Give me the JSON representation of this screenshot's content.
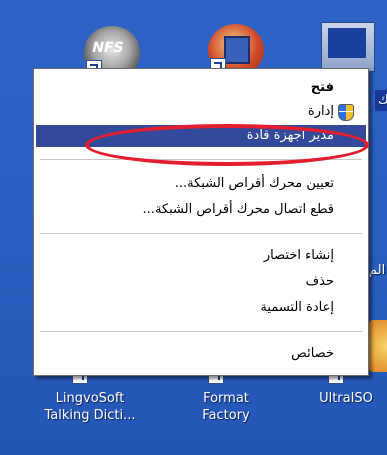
{
  "desktop": {
    "icons_top": [
      {
        "name": "nfs",
        "caption": "",
        "badge": "NFS"
      },
      {
        "name": "director",
        "caption": ""
      },
      {
        "name": "computer",
        "caption": ""
      }
    ],
    "partial_labels": [
      "الك",
      "الم"
    ],
    "icons_bottom": [
      {
        "line1": "LingvoSoft",
        "line2": "Talking Dicti..."
      },
      {
        "line1": "Format",
        "line2": "Factory"
      },
      {
        "line1": "UltraISO",
        "line2": ""
      }
    ]
  },
  "context_menu": {
    "items": [
      {
        "label": "فتح",
        "bold": true
      },
      {
        "label": "إدارة",
        "icon": "shield-icon"
      },
      {
        "label": "مدير اجهزة قادة",
        "highlighted": true
      },
      {
        "label": "تعيين محرك أقراص الشبكة..."
      },
      {
        "label": "قطع اتصال محرك أقراص الشبكة..."
      },
      {
        "label": "إنشاء اختصار"
      },
      {
        "label": "حذف"
      },
      {
        "label": "إعادة التسمية"
      },
      {
        "label": "خصائص"
      }
    ],
    "highlight_color": "#33499a",
    "annotation_color": "#e21e2f"
  }
}
